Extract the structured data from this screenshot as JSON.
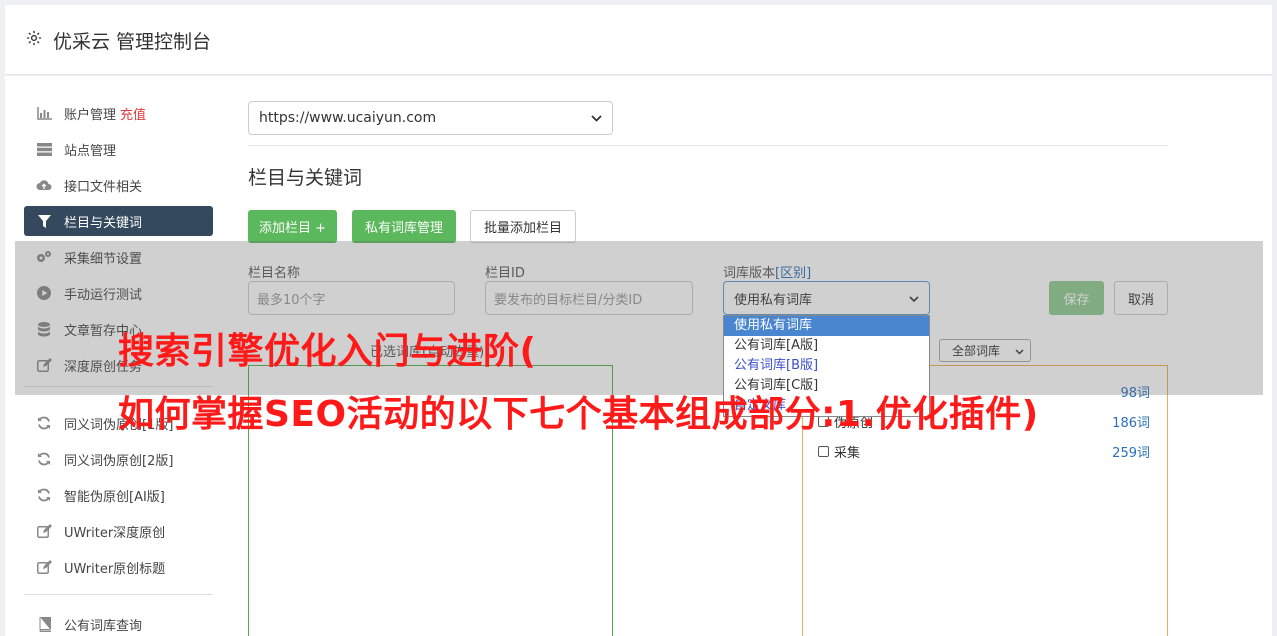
{
  "header": {
    "title": "优采云 管理控制台"
  },
  "sidebar": {
    "items": [
      {
        "label": "账户管理",
        "icon": "bar-chart-icon"
      },
      {
        "label": "站点管理",
        "icon": "server-icon"
      },
      {
        "label": "接口文件相关",
        "icon": "cloud-upload-icon"
      },
      {
        "label": "栏目与关键词",
        "icon": "filter-icon"
      },
      {
        "label": "采集细节设置",
        "icon": "gears-icon"
      },
      {
        "label": "手动运行测试",
        "icon": "play-circle-icon"
      },
      {
        "label": "文章暂存中心",
        "icon": "database-icon"
      },
      {
        "label": "深度原创任务",
        "icon": "edit-icon"
      },
      {
        "label": "同义词伪原创[1版]",
        "icon": "refresh-icon"
      },
      {
        "label": "同义词伪原创[2版]",
        "icon": "refresh-icon"
      },
      {
        "label": "智能伪原创[AI版]",
        "icon": "refresh-icon"
      },
      {
        "label": "UWriter深度原创",
        "icon": "edit-icon"
      },
      {
        "label": "UWriter原创标题",
        "icon": "edit-icon"
      },
      {
        "label": "公有词库查询",
        "icon": "book-icon"
      }
    ],
    "recharge": "充值"
  },
  "site": {
    "selected": "https://www.ucaiyun.com"
  },
  "section": {
    "title": "栏目与关键词"
  },
  "toolbar": {
    "add_column": "添加栏目 +",
    "private_lib": "私有词库管理",
    "batch_add": "批量添加栏目"
  },
  "form": {
    "col_name_label": "栏目名称",
    "col_name_placeholder": "最多10个字",
    "col_id_label": "栏目ID",
    "col_id_placeholder": "要发布的目标栏目/分类ID",
    "lib_version_label": "词库版本",
    "lib_version_diff": "[区别]",
    "lib_version_selected": "使用私有词库",
    "save": "保存",
    "cancel": "取消"
  },
  "dropdown": {
    "options": [
      "使用私有词库",
      "公有词库[A版]",
      "公有词库[B版]",
      "公有词库[C版]",
      "自定义库"
    ]
  },
  "chosen": {
    "label": "已选词库(自动去重)"
  },
  "library": {
    "filter_selected": "全部词库",
    "rows": [
      {
        "name": "伪原创",
        "count": "186词"
      },
      {
        "name": "采集",
        "count": "259词"
      }
    ],
    "partial_count": "98词"
  },
  "watermark": {
    "line1": "搜索引擎优化入门与进阶(",
    "line2": "如何掌握SEO活动的以下七个基本组成部分:1.优化插件)"
  }
}
